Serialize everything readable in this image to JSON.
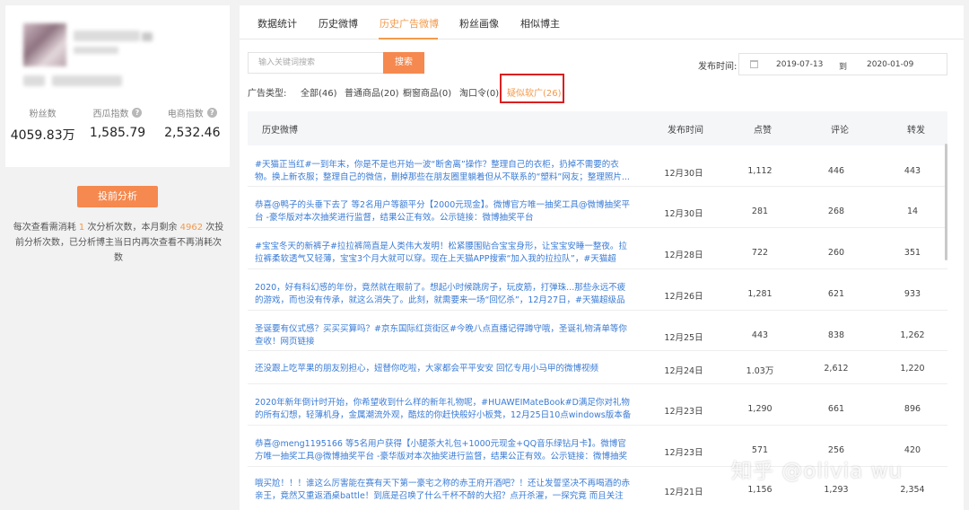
{
  "profile": {
    "stats": [
      {
        "label": "粉丝数",
        "value": "4059.83万"
      },
      {
        "label": "西瓜指数",
        "value": "1,585.79"
      },
      {
        "label": "电商指数",
        "value": "2,532.46"
      }
    ],
    "analyze_button": "投前分析",
    "quota_prefix": "每次查看需消耗",
    "quota_cost": "1",
    "quota_mid": "次分析次数，本月剩余",
    "quota_left": "4962",
    "quota_suffix": "次投前分析次数，已分析博主当日内再次查看不再消耗次数"
  },
  "tabs": [
    "数据统计",
    "历史微博",
    "历史广告微博",
    "粉丝画像",
    "相似博主"
  ],
  "active_tab": "历史广告微博",
  "search": {
    "placeholder": "输入关键词搜索",
    "button": "搜索"
  },
  "date": {
    "label": "发布时间:",
    "start": "2019-07-13",
    "to": "到",
    "end": "2020-01-09"
  },
  "filters": {
    "label": "广告类型:",
    "items": [
      "全部(46)",
      "普通商品(20)",
      "橱窗商品(0)",
      "淘口令(0)",
      "疑似软广(26)"
    ]
  },
  "table": {
    "headers": [
      "历史微博",
      "发布时间",
      "点赞",
      "评论",
      "转发"
    ],
    "rows": [
      {
        "text": "#天猫正当红#一到年末，你是不是也开始一波“断舍离”操作？整理自己的衣柜，扔掉不需要的衣物。换上新衣服；整理自己的微信，删掉那些在朋友圈里躺着但从不联系的“塑料”网友；整理照片...",
        "date": "12月30日",
        "likes": "1,112",
        "comments": "446",
        "reposts": "443"
      },
      {
        "text": "恭喜@鸭子的头垂下去了 等2名用户等额平分【2000元现金】。微博官方唯一抽奖工具@微博抽奖平台 -豪华版对本次抽奖进行监督，结果公正有效。公示链接：微博抽奖平台",
        "date": "12月30日",
        "likes": "281",
        "comments": "268",
        "reposts": "14"
      },
      {
        "text": "#宝宝冬天的新裤子#拉拉裤简直是人类伟大发明！松紧腰围贴合宝宝身形，让宝宝安睡一整夜。拉拉裤柔软透气又轻薄，宝宝3个月大就可以穿。现在上天猫APP搜索“加入我的拉拉队”，#天猫超级...",
        "date": "12月28日",
        "likes": "722",
        "comments": "260",
        "reposts": "351"
      },
      {
        "text": "2020，好有科幻感的年份，竟然就在眼前了。想起小时候跳房子，玩皮筋，打弹珠...那些永远不疲的游戏，而也没有传承，就这么消失了。此刻，就需要来一场“回忆杀”，12月27日，#天猫超级品牌...",
        "date": "12月26日",
        "likes": "1,281",
        "comments": "621",
        "reposts": "933"
      },
      {
        "text": "圣诞要有仪式感？买买买算吗？#京东国际红货街区#今晚八点直播记得蹲守哦，圣诞礼物清单等你查收！网页链接",
        "date": "12月25日",
        "likes": "443",
        "comments": "838",
        "reposts": "1,262"
      },
      {
        "text": "还没跟上吃苹果的朋友别担心，妞替你吃啦，大家都会平平安安 回忆专用小马甲的微博视频",
        "date": "12月24日",
        "likes": "1.03万",
        "comments": "2,612",
        "reposts": "1,220"
      },
      {
        "text": "2020年新年倒计时开始，你希望收到什么样的新年礼物呢，#HUAWEIMateBook#D满足你对礼物的所有幻想，轻薄机身，金属潮流外观，酷炫的你赶快般好小板凳，12月25日10点windows版本备",
        "date": "12月23日",
        "likes": "1,290",
        "comments": "661",
        "reposts": "896"
      },
      {
        "text": "恭喜@meng1195166 等5名用户获得【小腿茶大礼包+1000元现金+QQ音乐绿钻月卡】。微博官方唯一抽奖工具@微博抽奖平台 -豪华版对本次抽奖进行监督，结果公正有效。公示链接：微博抽奖平台",
        "date": "12月23日",
        "likes": "571",
        "comments": "256",
        "reposts": "420"
      },
      {
        "text": "哦买尬！！！谁这么厉害能在赛有天下第一豪宅之称的赤王府开酒吧？！还让发誓坚决不再喝酒的赤亲王，竟然又重返酒桌battle！到底是召唤了什么千杯不醉的大招？点开杀濯，一探究竟 而且关注开...",
        "date": "12月21日",
        "likes": "1,156",
        "comments": "1,293",
        "reposts": "2,354"
      }
    ]
  },
  "watermark": "知乎 @olivia wu"
}
